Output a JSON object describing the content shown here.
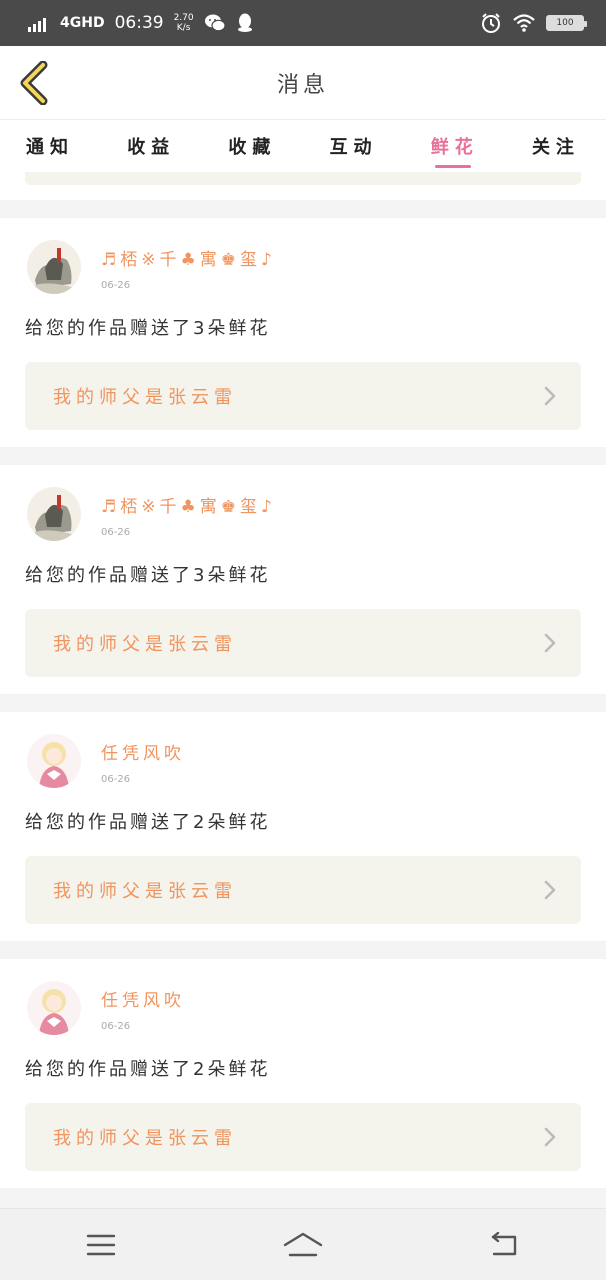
{
  "status_bar": {
    "network": "4GHD",
    "time": "06:39",
    "speed_value": "2.70",
    "speed_unit": "K/s",
    "battery": "100",
    "icons": [
      "signal-icon",
      "wechat-icon",
      "qq-icon",
      "alarm-icon",
      "wifi-icon",
      "battery-icon"
    ]
  },
  "header": {
    "title": "消息",
    "back_icon": "chevron-left-icon"
  },
  "tabs": [
    {
      "label": "通知",
      "active": false
    },
    {
      "label": "收益",
      "active": false
    },
    {
      "label": "收藏",
      "active": false
    },
    {
      "label": "互动",
      "active": false
    },
    {
      "label": "鲜花",
      "active": true
    },
    {
      "label": "关注",
      "active": false
    }
  ],
  "messages": [
    {
      "username": "♬桮※千♣寓♚玺♪",
      "date": "06-26",
      "text": "给您的作品赠送了3朵鲜花",
      "work_title": "我的师父是张云雷"
    },
    {
      "username": "♬桮※千♣寓♚玺♪",
      "date": "06-26",
      "text": "给您的作品赠送了3朵鲜花",
      "work_title": "我的师父是张云雷"
    },
    {
      "username": "任凭风吹",
      "date": "06-26",
      "text": "给您的作品赠送了2朵鲜花",
      "work_title": "我的师父是张云雷"
    },
    {
      "username": "任凭风吹",
      "date": "06-26",
      "text": "给您的作品赠送了2朵鲜花",
      "work_title": "我的师父是张云雷"
    }
  ],
  "colors": {
    "accent_pink": "#e8709a",
    "orange_text": "#f0955f",
    "link_bg": "#f4f3ec",
    "status_bar_bg": "#4a4a4a"
  },
  "navbar": {
    "icons": [
      "menu-icon",
      "home-icon",
      "back-nav-icon"
    ]
  }
}
